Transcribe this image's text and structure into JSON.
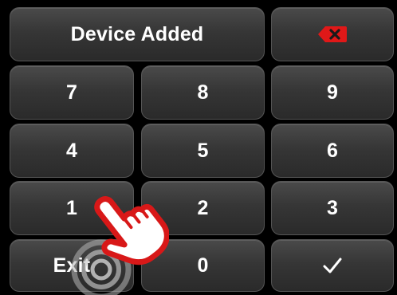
{
  "display": {
    "status_text": "Device Added"
  },
  "keys": {
    "backspace_icon": "backspace-icon",
    "k7": "7",
    "k8": "8",
    "k9": "9",
    "k4": "4",
    "k5": "5",
    "k6": "6",
    "k1": "1",
    "k2": "2",
    "k3": "3",
    "exit": "Exit",
    "k0": "0",
    "confirm": "✓"
  },
  "colors": {
    "key_background": "#363636",
    "backspace_accent": "#e01818",
    "hand_accent": "#d81818",
    "background": "#000000"
  }
}
